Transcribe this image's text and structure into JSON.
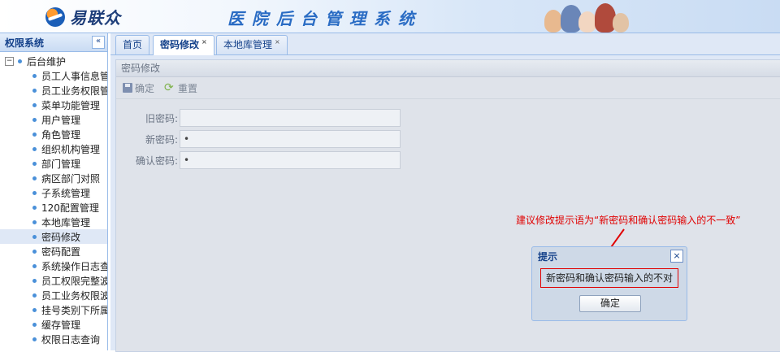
{
  "header": {
    "logo_text": "易联众",
    "system_title": "医院后台管理系统"
  },
  "sidebar": {
    "title": "权限系统",
    "collapse_label": "«",
    "root": {
      "expander": "−",
      "label": "后台维护"
    },
    "items": [
      {
        "label": "员工人事信息管"
      },
      {
        "label": "员工业务权限管"
      },
      {
        "label": "菜单功能管理"
      },
      {
        "label": "用户管理"
      },
      {
        "label": "角色管理"
      },
      {
        "label": "组织机构管理"
      },
      {
        "label": "部门管理"
      },
      {
        "label": "病区部门对照"
      },
      {
        "label": "子系统管理"
      },
      {
        "label": "120配置管理"
      },
      {
        "label": "本地库管理"
      },
      {
        "label": "密码修改"
      },
      {
        "label": "密码配置"
      },
      {
        "label": "系统操作日志查"
      },
      {
        "label": "员工权限完整波"
      },
      {
        "label": "员工业务权限波"
      },
      {
        "label": "挂号类别下所属"
      },
      {
        "label": "缓存管理"
      },
      {
        "label": "权限日志查询"
      }
    ],
    "selected_index": 11
  },
  "tabs": [
    {
      "label": "首页",
      "closable": false
    },
    {
      "label": "密码修改",
      "closable": true,
      "close": "×"
    },
    {
      "label": "本地库管理",
      "closable": true,
      "close": "×"
    }
  ],
  "panel": {
    "title": "密码修改",
    "toolbar": {
      "confirm_label": "确定",
      "reset_label": "重置"
    },
    "fields": [
      {
        "label": "旧密码:",
        "value": ""
      },
      {
        "label": "新密码:",
        "value": "•"
      },
      {
        "label": "确认密码:",
        "value": "•"
      }
    ]
  },
  "annotation": {
    "text": "建议修改提示语为“新密码和确认密码输入的不一致”"
  },
  "dialog": {
    "title": "提示",
    "close": "×",
    "message": "新密码和确认密码输入的不对",
    "ok_label": "确定"
  },
  "colors": {
    "accent": "#15428b",
    "annotation": "#e00000",
    "border": "#99bbe8"
  }
}
